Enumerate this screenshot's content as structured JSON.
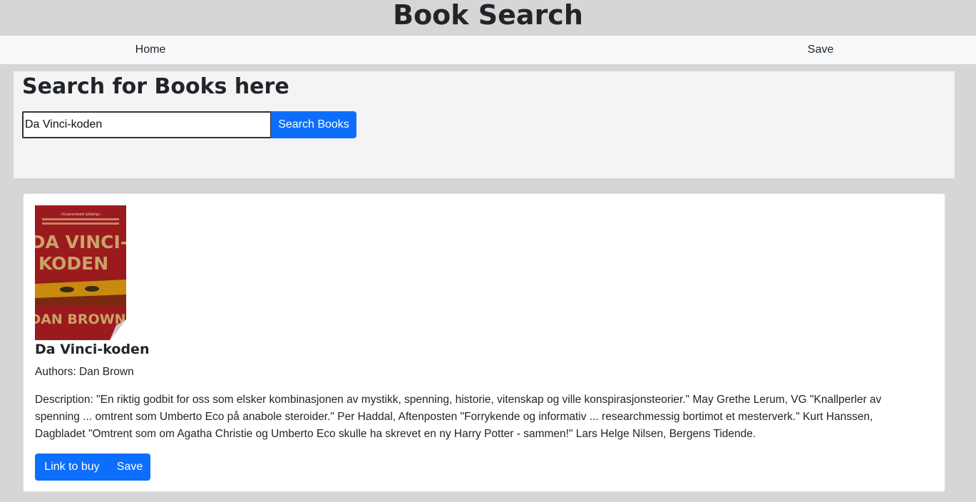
{
  "header": {
    "title": "Book Search"
  },
  "nav": {
    "home_label": "Home",
    "save_label": "Save"
  },
  "search": {
    "heading": "Search for Books here",
    "input_value": "Da Vinci-koden",
    "button_label": "Search Books"
  },
  "results": [
    {
      "cover": {
        "top_text": "«Guaranteed lykkelig»",
        "title_line1": "DA VINCI-",
        "title_line2": "KODEN",
        "author": "DAN BROWN",
        "colors": {
          "background": "#9b1a1e",
          "text": "#c9a36a",
          "band": "#c98a10"
        }
      },
      "title": "Da Vinci-koden",
      "authors": "Authors: Dan Brown",
      "description": "Description: \"En riktig godbit for oss som elsker kombinasjonen av mystikk, spenning, historie, vitenskap og ville konspirasjonsteorier.\" May Grethe Lerum, VG \"Knallperler av spenning ... omtrent som Umberto Eco på anabole steroider.\" Per Haddal, Aftenposten \"Forrykende og informativ ... researchmessig bortimot et mesterverk.\" Kurt Hanssen, Dagbladet \"Omtrent som om Agatha Christie og Umberto Eco skulle ha skrevet en ny Harry Potter - sammen!\" Lars Helge Nilsen, Bergens Tidende.",
      "buy_label": "Link to buy",
      "save_label": "Save"
    }
  ],
  "colors": {
    "accent": "#0d6efd",
    "page_background": "#d6d6d6",
    "nav_background": "#f8f9fa"
  }
}
